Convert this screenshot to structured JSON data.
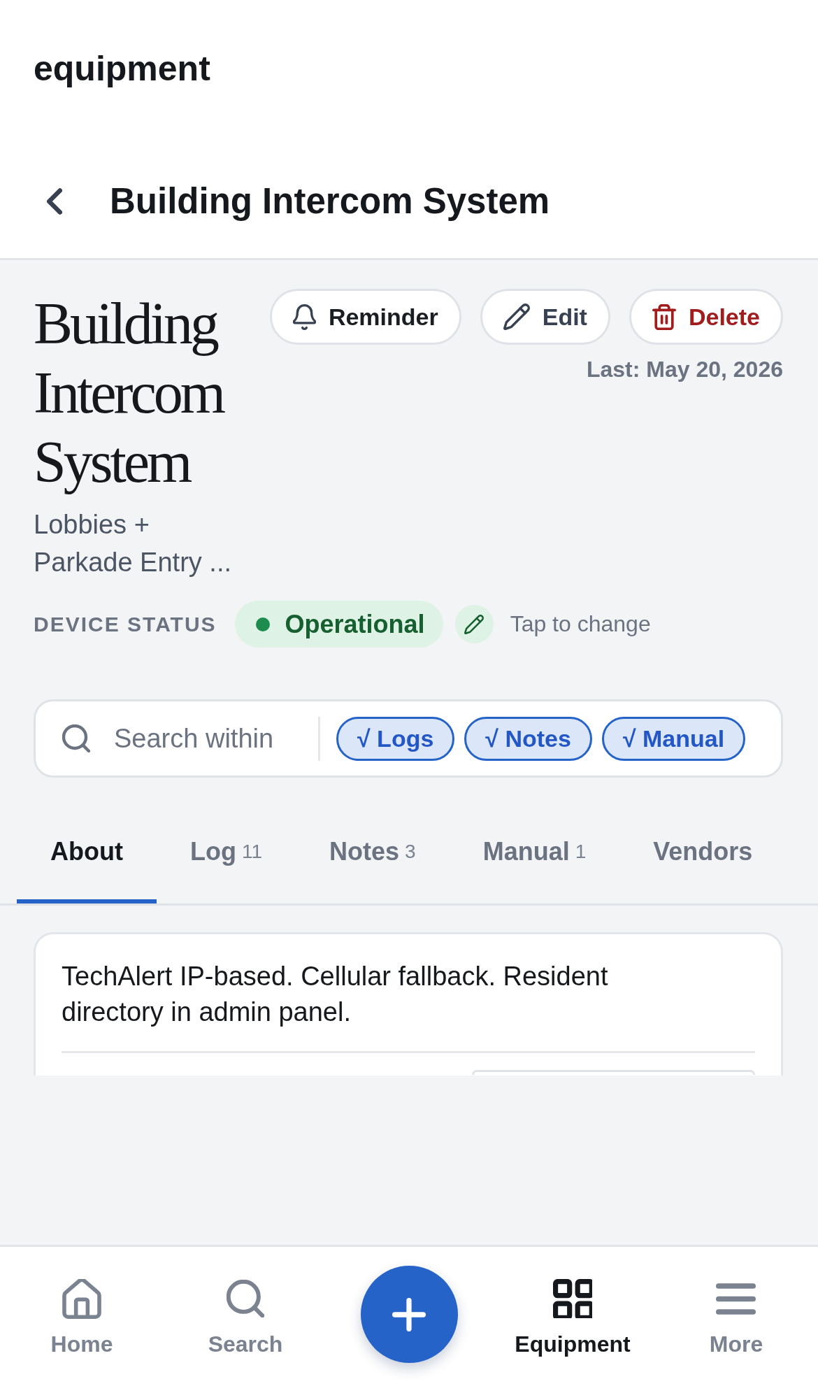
{
  "app_bar": {
    "title": "equipment"
  },
  "header": {
    "title": "Building Intercom System"
  },
  "device": {
    "name": "Building Intercom System",
    "location": "Lobbies + Parkade Entry ...",
    "last_updated": "Last: May 20, 2026"
  },
  "actions": [
    {
      "kind": "reminder",
      "label": "Reminder"
    },
    {
      "kind": "edit",
      "label": "Edit"
    },
    {
      "kind": "delete",
      "label": "Delete"
    }
  ],
  "status": {
    "label": "DEVICE STATUS",
    "value": "Operational",
    "hint": "Tap to change"
  },
  "search": {
    "placeholder": "Search within",
    "filters": [
      {
        "label": "√ Logs",
        "selected": true
      },
      {
        "label": "√ Notes",
        "selected": true
      },
      {
        "label": "√ Manual",
        "selected": true
      }
    ]
  },
  "tabs": [
    {
      "label": "About",
      "selected": true
    },
    {
      "label": "Log",
      "count": "11",
      "selected": false
    },
    {
      "label": "Notes",
      "count": "3",
      "selected": false
    },
    {
      "label": "Manual",
      "count": "1",
      "selected": false
    },
    {
      "label": "Vendors",
      "selected": false
    }
  ],
  "about": {
    "text": "TechAlert IP-based. Cellular fallback. Resident directory in admin panel."
  },
  "bottom_nav": [
    {
      "kind": "tab",
      "label": "Home",
      "selected": false
    },
    {
      "kind": "tab",
      "label": "Search",
      "selected": false
    },
    {
      "kind": "fab",
      "selected": false
    },
    {
      "kind": "tab",
      "label": "Equipment",
      "selected": true
    },
    {
      "kind": "tab",
      "label": "More",
      "selected": false
    }
  ]
}
